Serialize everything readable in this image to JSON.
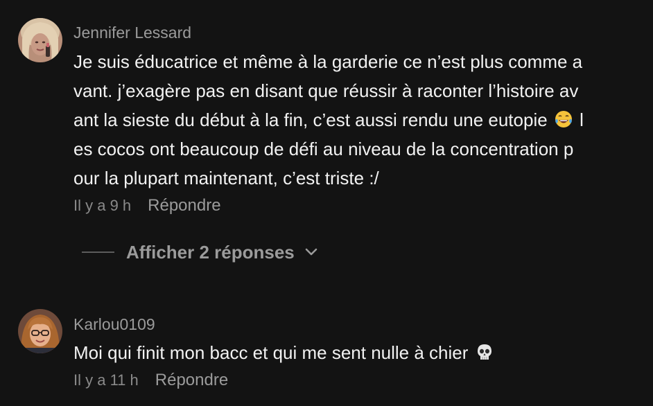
{
  "comments": [
    {
      "username": "Jennifer Lessard",
      "avatar_icon": "user-avatar-photo",
      "text_lines": [
        "Je suis éducatrice et même à la garderie ce n’est plus comme a",
        "vant. j’exagère pas en disant que réussir à raconter l’histoire av",
        "ant la sieste du début à la fin, c’est aussi rendu une eutopie",
        "l",
        "es cocos ont beaucoup de défi au niveau de la concentration p",
        "our la plupart maintenant, c’est triste :/"
      ],
      "emoji": "😂",
      "time": "Il y a 9 h",
      "reply_label": "Répondre"
    },
    {
      "username": "Karlou0109",
      "avatar_icon": "user-avatar-photo",
      "text": "Moi qui finit mon bacc et qui me sent nulle à chier",
      "emoji": "💀",
      "time": "Il y a 11 h",
      "reply_label": "Répondre"
    }
  ],
  "view_replies": {
    "label": "Afficher 2 réponses",
    "icon": "chevron-down-icon"
  },
  "colors": {
    "background": "#131313",
    "text": "#f2f2f2",
    "muted": "#9b9b9b"
  }
}
